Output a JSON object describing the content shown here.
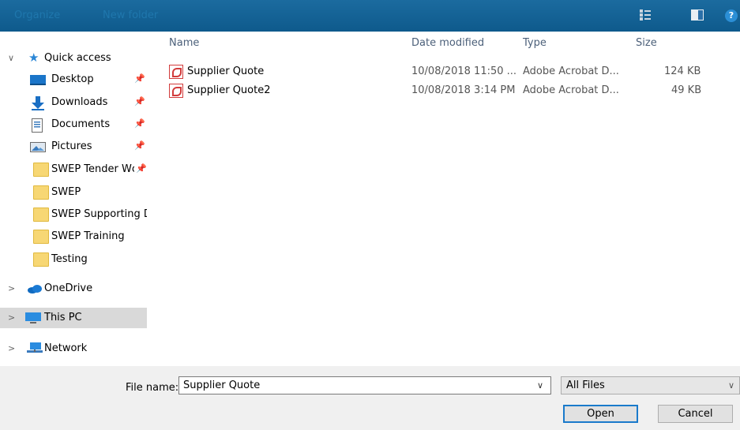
{
  "toolbar": {
    "organize_label": "Organize",
    "new_folder_label": "New folder",
    "view_icon": "view-options-icon",
    "preview_icon": "preview-pane-icon",
    "help_label": "?"
  },
  "sidebar": {
    "items": [
      {
        "label": "Quick access",
        "icon": "star-icon",
        "pinned": false
      },
      {
        "label": "Desktop",
        "icon": "desktop-icon",
        "pinned": true
      },
      {
        "label": "Downloads",
        "icon": "download-icon",
        "pinned": true
      },
      {
        "label": "Documents",
        "icon": "documents-icon",
        "pinned": true
      },
      {
        "label": "Pictures",
        "icon": "pictures-icon",
        "pinned": true
      },
      {
        "label": "SWEP Tender Wc",
        "icon": "folder-icon",
        "pinned": true
      },
      {
        "label": "SWEP",
        "icon": "folder-icon",
        "pinned": false
      },
      {
        "label": "SWEP Supporting D",
        "icon": "folder-icon",
        "pinned": false
      },
      {
        "label": "SWEP Training",
        "icon": "folder-icon",
        "pinned": false
      },
      {
        "label": "Testing",
        "icon": "folder-icon",
        "pinned": false
      },
      {
        "label": "OneDrive",
        "icon": "cloud-icon",
        "pinned": false
      },
      {
        "label": "This PC",
        "icon": "computer-icon",
        "pinned": false
      },
      {
        "label": "Network",
        "icon": "network-icon",
        "pinned": false
      }
    ]
  },
  "columns": {
    "name": "Name",
    "date": "Date modified",
    "type": "Type",
    "size": "Size"
  },
  "files": [
    {
      "name": "Supplier Quote",
      "date": "10/08/2018 11:50 ...",
      "type": "Adobe Acrobat D...",
      "size": "124 KB"
    },
    {
      "name": "Supplier Quote2",
      "date": "10/08/2018 3:14 PM",
      "type": "Adobe Acrobat D...",
      "size": "49 KB"
    }
  ],
  "footer": {
    "file_name_label": "File name:",
    "file_name_value": "Supplier Quote",
    "file_type_value": "All Files",
    "open_label": "Open",
    "cancel_label": "Cancel"
  }
}
